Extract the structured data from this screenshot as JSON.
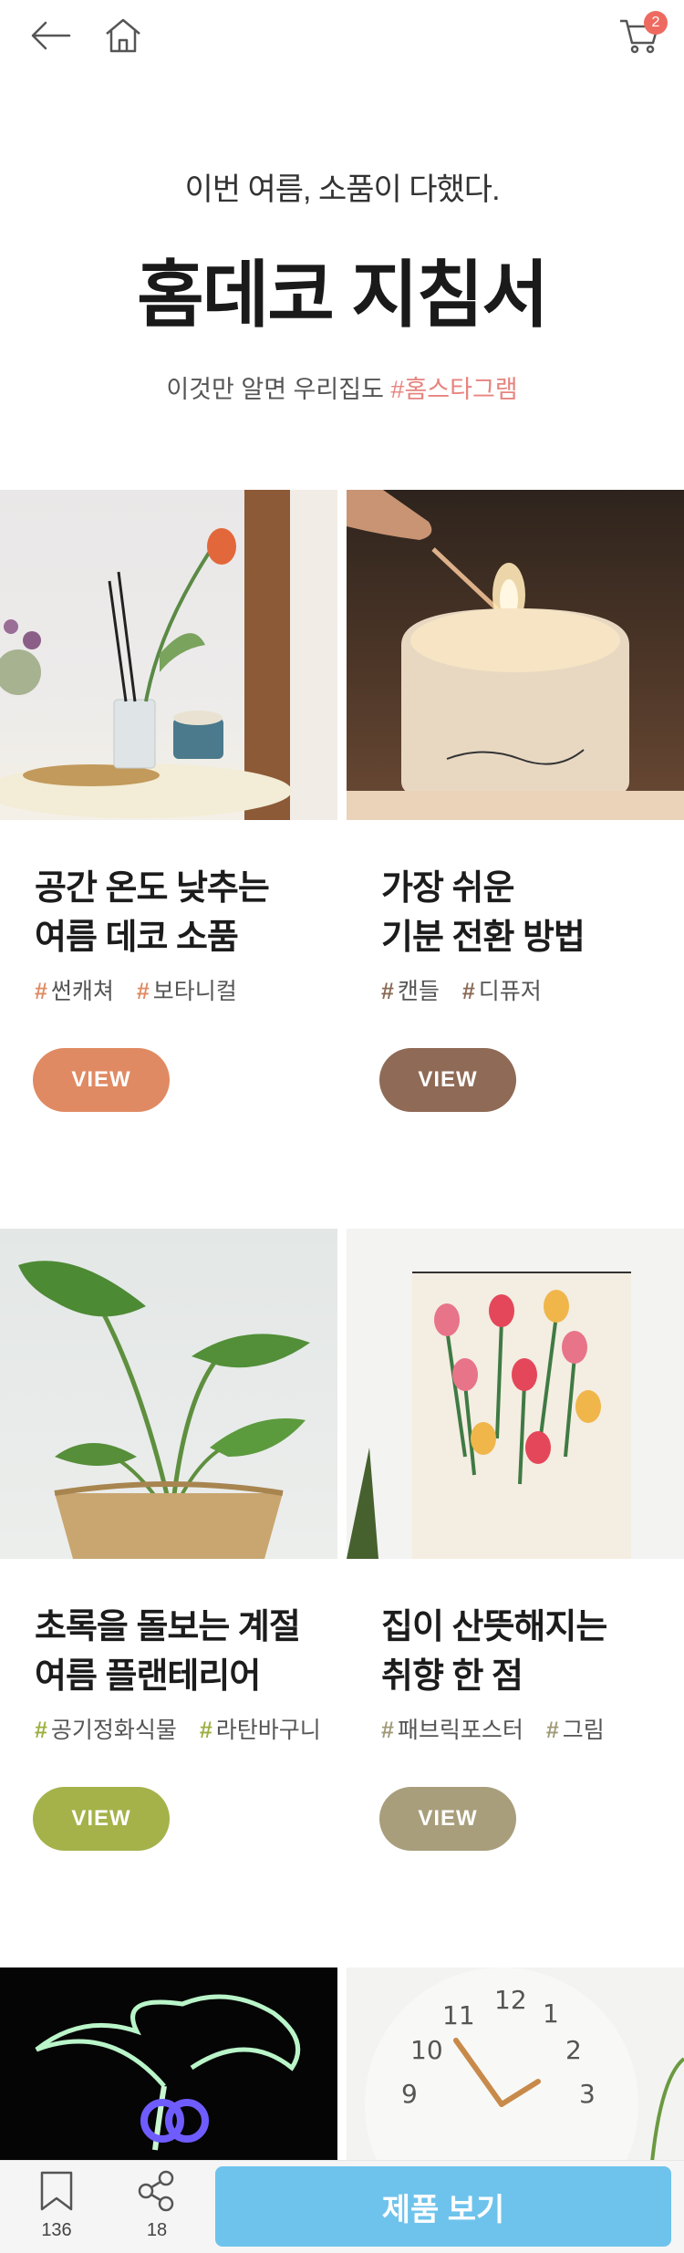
{
  "cart": {
    "count": "2"
  },
  "hero": {
    "subtitle": "이번 여름, 소품이 다했다.",
    "title": "홈데코 지침서",
    "desc_prefix": "이것만 알면 우리집도 ",
    "desc_tag": "#홈스타그램"
  },
  "cards": [
    {
      "line1": "공간 온도 낮추는",
      "line2": "여름 데코 소품",
      "tags": [
        "썬캐쳐",
        "보타니컬"
      ],
      "tag_color": "#e08a63",
      "view_label": "VIEW",
      "button_color": "#e08a63",
      "image": "diffuser-and-tulip-photo"
    },
    {
      "line1": "가장 쉬운",
      "line2": "기분 전환 방법",
      "tags": [
        "캔들",
        "디퓨저"
      ],
      "tag_color": "#8a6a55",
      "view_label": "VIEW",
      "button_color": "#8f6a56",
      "image": "lighting-candle-photo"
    },
    {
      "line1": "초록을 돌보는 계절",
      "line2": "여름 플랜테리어",
      "tags": [
        "공기정화식물",
        "라탄바구니"
      ],
      "tag_color": "#9caf3f",
      "view_label": "VIEW",
      "button_color": "#a5b24a",
      "image": "potted-plant-photo"
    },
    {
      "line1": "집이 산뜻해지는",
      "line2": "취향 한 점",
      "tags": [
        "패브릭포스터",
        "그림"
      ],
      "tag_color": "#a09a78",
      "view_label": "VIEW",
      "button_color": "#a89e7c",
      "image": "tulip-fabric-poster-photo"
    },
    {
      "image": "neon-palm-sign-photo"
    },
    {
      "image": "wall-clock-photo"
    }
  ],
  "bottom": {
    "bookmark_count": "136",
    "share_count": "18",
    "cta_label": "제품 보기"
  }
}
